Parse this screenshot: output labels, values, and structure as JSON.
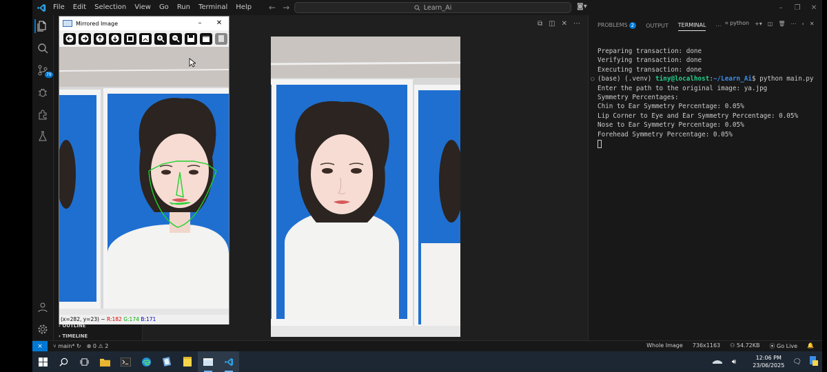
{
  "titlebar": {
    "menu": [
      "File",
      "Edit",
      "Selection",
      "View",
      "Go",
      "Run",
      "Terminal",
      "Help"
    ],
    "search_text": "Learn_Ai"
  },
  "activity": {
    "source_control_badge": "79"
  },
  "sidebar": {
    "sections": [
      "OUTLINE",
      "TIMELINE"
    ]
  },
  "panel": {
    "tabs": {
      "problems": "PROBLEMS",
      "problems_count": "2",
      "output": "OUTPUT",
      "terminal": "TERMINAL"
    },
    "shell_label": "python",
    "terminal_lines": [
      "Preparing transaction: done",
      "Verifying transaction: done",
      "Executing transaction: done"
    ],
    "prompt_prefix": "(base) (.venv) ",
    "prompt_user": "tiny@localhost",
    "prompt_colon": ":",
    "prompt_path": "~/Learn_Ai",
    "prompt_cmd": "$ python main.py",
    "output_lines": [
      "Enter the path to the original image: ya.jpg",
      "Symmetry Percentages:",
      "Chin to Ear Symmetry Percentage: 0.05%",
      "Lip Corner to Eye and Ear Symmetry Percentage: 0.05%",
      "Nose to Ear Symmetry Percentage: 0.05%",
      "Forehead Symmetry Percentage: 0.05%"
    ]
  },
  "status": {
    "branch": "main*",
    "errors": "0",
    "warnings": "2",
    "image_mode": "Whole Image",
    "image_size": "736x1163",
    "file_size": "54.72KB",
    "go_live": "Go Live"
  },
  "cv_window": {
    "title": "Mirrored Image",
    "coords": "(x=282, y=23) ~ ",
    "r": "R:182",
    "g": "G:174",
    "b": "B:171"
  },
  "taskbar": {
    "time": "12:06 PM",
    "date": "23/06/2025"
  },
  "colors": {
    "accent": "#0078d4",
    "terminal_user": "#23d18b",
    "terminal_path": "#3b8eea",
    "photo_background_blue": "#1f6fd0"
  }
}
